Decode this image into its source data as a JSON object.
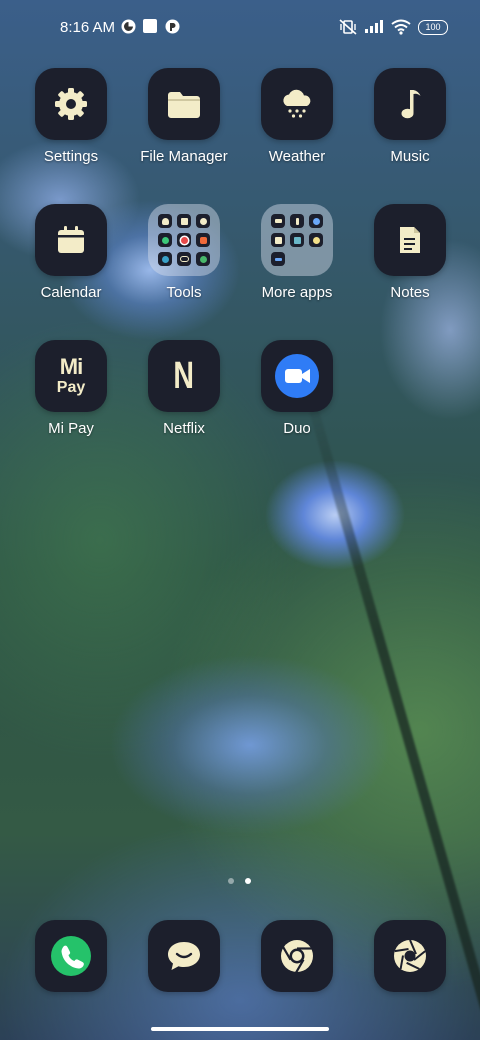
{
  "status_bar": {
    "time": "8:16 AM",
    "battery": "100",
    "icons": [
      "notification-icon-1",
      "notification-icon-2",
      "notification-icon-3",
      "mute-icon",
      "signal-icon",
      "wifi-icon",
      "battery-icon"
    ]
  },
  "apps": [
    {
      "label": "Settings",
      "icon": "gear-icon"
    },
    {
      "label": "File Manager",
      "icon": "folder-icon"
    },
    {
      "label": "Weather",
      "icon": "cloud-snow-icon"
    },
    {
      "label": "Music",
      "icon": "music-note-icon"
    },
    {
      "label": "Calendar",
      "icon": "calendar-icon"
    },
    {
      "label": "Tools",
      "icon": "folder-preview"
    },
    {
      "label": "More apps",
      "icon": "folder-preview"
    },
    {
      "label": "Notes",
      "icon": "notes-icon"
    },
    {
      "label": "Mi Pay",
      "icon": "mi-pay-icon"
    },
    {
      "label": "Netflix",
      "icon": "netflix-icon"
    },
    {
      "label": "Duo",
      "icon": "video-camera-icon"
    }
  ],
  "icon_text": {
    "mipay_top": "Mi",
    "mipay_bottom": "Pay",
    "netflix": "N"
  },
  "dock": [
    {
      "name": "phone",
      "icon": "phone-icon"
    },
    {
      "name": "messages",
      "icon": "chat-icon"
    },
    {
      "name": "chrome",
      "icon": "chrome-icon"
    },
    {
      "name": "camera",
      "icon": "camera-aperture-icon"
    }
  ],
  "page_indicator": {
    "pages": 2,
    "current": 2
  },
  "colors": {
    "icon_tile": "#1c1f2c",
    "icon_glyph": "#f3ecc8",
    "duo_blue": "#2f7cf6",
    "phone_green": "#25c26a"
  }
}
